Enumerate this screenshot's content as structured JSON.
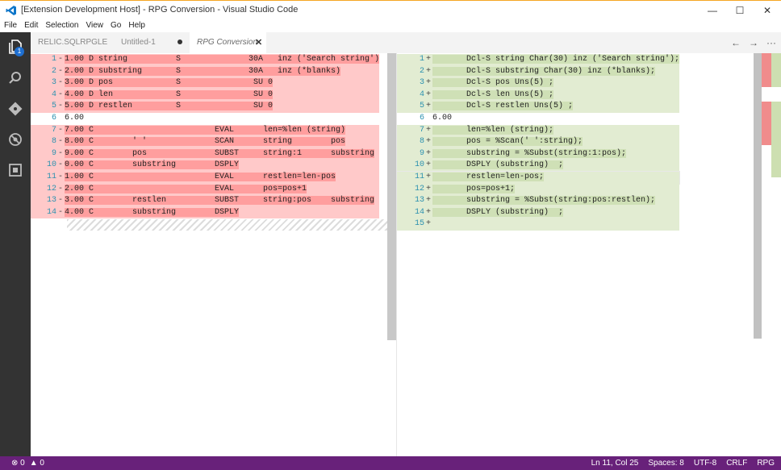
{
  "window": {
    "title": "[Extension Development Host] - RPG Conversion - Visual Studio Code",
    "buttons": {
      "minimize": "—",
      "maximize": "☐",
      "close": "✕"
    }
  },
  "menu": [
    "File",
    "Edit",
    "Selection",
    "View",
    "Go",
    "Help"
  ],
  "activity": {
    "badge": "1"
  },
  "tabs": [
    {
      "label": "RELIC.SQLRPGLE",
      "state": "normal"
    },
    {
      "label": "Untitled-1",
      "state": "dirty"
    },
    {
      "label": "RPG Conversion",
      "state": "active"
    }
  ],
  "tab_actions": {
    "back": "←",
    "forward": "→",
    "more": "···"
  },
  "left_lines": [
    {
      "n": "1",
      "s": "-",
      "t": "1.00 D string          S              30A   inz ('Search string')",
      "type": "del"
    },
    {
      "n": "2",
      "s": "-",
      "t": "2.00 D substring       S              30A   inz (*blanks)",
      "type": "del"
    },
    {
      "n": "3",
      "s": "-",
      "t": "3.00 D pos             S               SU 0",
      "type": "del"
    },
    {
      "n": "4",
      "s": "-",
      "t": "4.00 D len             S               SU 0",
      "type": "del"
    },
    {
      "n": "5",
      "s": "-",
      "t": "5.00 D restlen         S               SU 0",
      "type": "del"
    },
    {
      "n": "6",
      "s": "",
      "t": "6.00",
      "type": "normal"
    },
    {
      "n": "7",
      "s": "-",
      "t": "7.00 C                         EVAL      len=%len (string)",
      "type": "del"
    },
    {
      "n": "8",
      "s": "-",
      "t": "8.00 C        ' '              SCAN      string        pos",
      "type": "del"
    },
    {
      "n": "9",
      "s": "-",
      "t": "9.00 C        pos              SUBST     string:1      substring",
      "type": "del"
    },
    {
      "n": "10",
      "s": "-",
      "t": "0.00 C        substring        DSPLY",
      "type": "del"
    },
    {
      "n": "11",
      "s": "-",
      "t": "1.00 C                         EVAL      restlen=len-pos",
      "type": "del"
    },
    {
      "n": "12",
      "s": "-",
      "t": "2.00 C                         EVAL      pos=pos+1",
      "type": "del"
    },
    {
      "n": "13",
      "s": "-",
      "t": "3.00 C        restlen          SUBST     string:pos    substring",
      "type": "del"
    },
    {
      "n": "14",
      "s": "-",
      "t": "4.00 C        substring        DSPLY",
      "type": "del"
    }
  ],
  "right_lines": [
    {
      "n": "1",
      "s": "+",
      "t": "       Dcl-S string Char(30) inz ('Search string');",
      "type": "ins"
    },
    {
      "n": "2",
      "s": "+",
      "t": "       Dcl-S substring Char(30) inz (*blanks);",
      "type": "ins"
    },
    {
      "n": "3",
      "s": "+",
      "t": "       Dcl-S pos Uns(5) ;",
      "type": "ins"
    },
    {
      "n": "4",
      "s": "+",
      "t": "       Dcl-S len Uns(5) ;",
      "type": "ins"
    },
    {
      "n": "5",
      "s": "+",
      "t": "       Dcl-S restlen Uns(5) ;",
      "type": "ins"
    },
    {
      "n": "6",
      "s": "",
      "t": "6.00",
      "type": "normal"
    },
    {
      "n": "7",
      "s": "+",
      "t": "       len=%len (string);",
      "type": "ins"
    },
    {
      "n": "8",
      "s": "+",
      "t": "       pos = %Scan(' ':string);",
      "type": "ins"
    },
    {
      "n": "9",
      "s": "+",
      "t": "       substring = %Subst(string:1:pos);",
      "type": "ins"
    },
    {
      "n": "10",
      "s": "+",
      "t": "       DSPLY (substring)  ;",
      "type": "ins"
    },
    {
      "n": "11",
      "s": "+",
      "t": "       restlen=len-pos;",
      "type": "ins cur"
    },
    {
      "n": "12",
      "s": "+",
      "t": "       pos=pos+1;",
      "type": "ins"
    },
    {
      "n": "13",
      "s": "+",
      "t": "       substring = %Subst(string:pos:restlen);",
      "type": "ins"
    },
    {
      "n": "14",
      "s": "+",
      "t": "       DSPLY (substring)  ;",
      "type": "ins"
    },
    {
      "n": "15",
      "s": "+",
      "t": "",
      "type": "ins"
    }
  ],
  "status": {
    "errors": "0",
    "warnings": "0",
    "position": "Ln 11, Col 25",
    "spaces": "Spaces: 8",
    "encoding": "UTF-8",
    "eol": "CRLF",
    "language": "RPG"
  },
  "colors": {
    "status_bar": "#68217a",
    "activity_bar": "#333333",
    "deleted_line": "#ffc9c9",
    "deleted_text": "#ff9e9e",
    "inserted_line": "#e2ecd2",
    "inserted_text": "#cfe0b6"
  }
}
